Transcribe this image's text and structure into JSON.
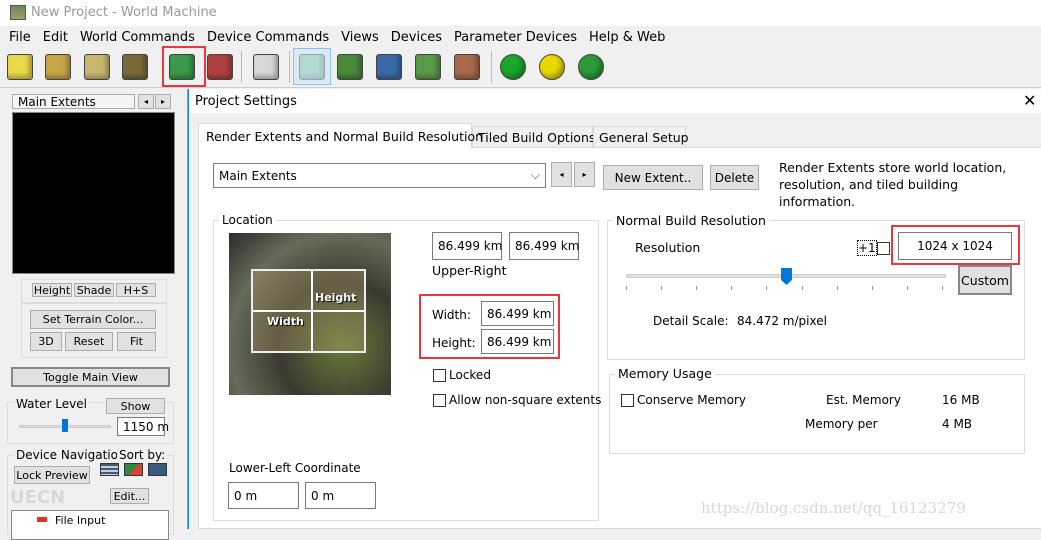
{
  "window": {
    "title": "New Project - World Machine"
  },
  "menu": [
    "File",
    "Edit",
    "World Commands",
    "Device Commands",
    "Views",
    "Devices",
    "Parameter Devices",
    "Help & Web"
  ],
  "toolbar": [
    {
      "icon": "new-project-icon",
      "color": "#e8d84a"
    },
    {
      "icon": "open-folder-icon",
      "color": "#c8a64a"
    },
    {
      "icon": "save-disk-icon",
      "color": "#c9b770"
    },
    {
      "icon": "export-icon",
      "color": "#7a6a3a"
    },
    {
      "icon": "project-settings-icon",
      "color": "#3a9a4a"
    },
    {
      "icon": "checklist-icon",
      "color": "#b04040"
    },
    {
      "icon": "dice-icon",
      "color": "#d8d8d8"
    },
    {
      "icon": "device-view-icon",
      "color": "#8fc79a"
    },
    {
      "icon": "layout-view-icon",
      "color": "#4a8a3a"
    },
    {
      "icon": "globe-icon",
      "color": "#3a6aa8"
    },
    {
      "icon": "terrain-3d-icon",
      "color": "#5a9a4a"
    },
    {
      "icon": "texture-icon",
      "color": "#a86a4a"
    },
    {
      "icon": "build-green-icon",
      "color": "#1aa82a"
    },
    {
      "icon": "build-yellow-icon",
      "color": "#e8d800"
    },
    {
      "icon": "build-tiled-icon",
      "color": "#2a9a3a"
    }
  ],
  "left_panel": {
    "extent_name": "Main Extents",
    "view_buttons": [
      "Height",
      "Shade",
      "H+S"
    ],
    "set_terrain_color": "Set Terrain Color...",
    "buttons": [
      "3D",
      "Reset",
      "Fit"
    ],
    "toggle_main_view": "Toggle Main View",
    "water_level": {
      "label": "Water Level",
      "show": "Show",
      "value": "1150 m",
      "slider_fraction": 0.5
    },
    "device_navigation": {
      "label": "Device Navigation",
      "sort_by": "Sort by:",
      "lock_preview": "Lock Preview",
      "edit": "Edit...",
      "tree_item": "File Input"
    }
  },
  "dialog": {
    "title": "Project Settings",
    "tabs": [
      "Render Extents and Normal Build Resolution",
      "Tiled Build Options",
      "General Setup"
    ],
    "extent_select": "Main Extents",
    "new_extent": "New Extent..",
    "delete": "Delete",
    "info": "Render Extents store world location, resolution, and tiled building information.",
    "location": {
      "label": "Location",
      "image_labels": {
        "height": "Height",
        "width": "Width"
      },
      "upper_right": [
        "86.499 km",
        "86.499 km"
      ],
      "upper_right_label": "Upper-Right",
      "width_label": "Width:",
      "width": "86.499 km",
      "height_label": "Height:",
      "height": "86.499 km",
      "locked": "Locked",
      "allow_non_square": "Allow non-square extents",
      "lower_left_label": "Lower-Left Coordinate",
      "lower_left": [
        "0 m",
        "0 m"
      ]
    },
    "normal_build": {
      "label": "Normal Build Resolution",
      "resolution_label": "Resolution",
      "plus_one": "+1",
      "resolution": "1024 x 1024",
      "custom": "Custom",
      "slider_fraction": 0.5,
      "detail_scale_label": "Detail Scale:",
      "detail_scale": "84.472 m/pixel"
    },
    "memory": {
      "label": "Memory Usage",
      "conserve": "Conserve Memory",
      "est_label": "Est. Memory",
      "est": "16 MB",
      "per_label": "Memory per",
      "per": "4 MB"
    }
  },
  "watermarks": {
    "csdn": "https://blog.csdn.net/qq_16123279",
    "unrealchina": "UECN 虚幻中国社区 UnrealChina.COM"
  }
}
